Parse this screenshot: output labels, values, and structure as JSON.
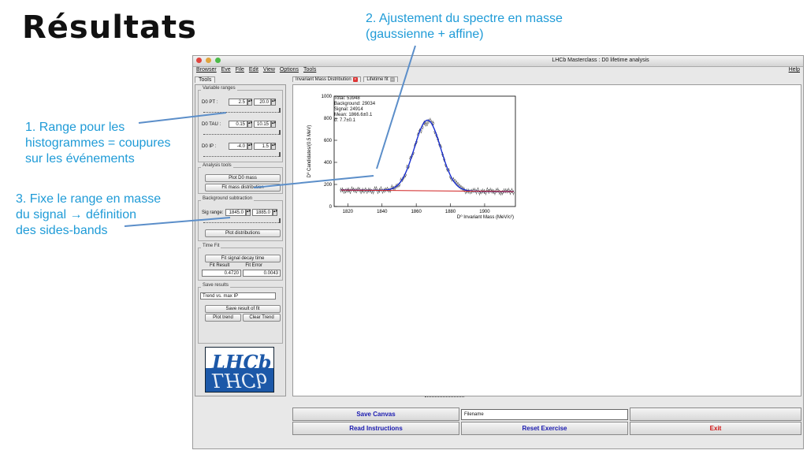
{
  "slide": {
    "title": "Résultats",
    "annotations": {
      "a1": [
        "1. Range pour les",
        "histogrammes = coupures",
        "sur les événements"
      ],
      "a2": [
        "2. Ajustement du spectre en masse",
        "(gaussienne + affine)"
      ],
      "a3": [
        "3. Fixe le range en masse",
        "du signal → définition",
        "des sides-bands"
      ]
    },
    "accent_color": "#1f9bd7"
  },
  "window": {
    "title": "LHCb Masterclass : D0 lifetime analysis",
    "menu": [
      "Browser",
      "Eve",
      "File",
      "Edit",
      "View",
      "Options",
      "Tools"
    ],
    "help": "Help"
  },
  "left": {
    "tab": "Tools",
    "variable_ranges": {
      "label": "Variable ranges",
      "pt_label": "D0 PT :",
      "pt_min": "2.5",
      "pt_max": "20.0",
      "tau_label": "D0 TAU :",
      "tau_min": "0.15",
      "tau_max": "10.15",
      "ip_label": "D0 IP :",
      "ip_min": "-4.0",
      "ip_max": "1.5"
    },
    "analysis": {
      "label": "Analysis tools",
      "plot": "Plot D0 mass",
      "fit": "Fit mass distribution"
    },
    "background": {
      "label": "Background subtraction",
      "sig_label": "Sig range:",
      "sig_min": "1845.0",
      "sig_max": "1885.0",
      "plot": "Plot distributions"
    },
    "timefit": {
      "label": "Time Fit",
      "fit": "Fit signal decay time",
      "result_label": "Fit Result",
      "error_label": "Fit Error",
      "result": "0.4720",
      "error": "0.0043"
    },
    "save": {
      "label": "Save results",
      "select": "Trend vs. max IP",
      "save_fit": "Save result of fit",
      "plot_trend": "Plot trend",
      "clear_trend": "Clear Trend"
    },
    "logo": "LHCb"
  },
  "main": {
    "tabs": [
      "Invariant Mass Distribution",
      "Lifetime fit"
    ]
  },
  "stats": [
    "Total: 53948",
    "Background: 29034",
    "Signal: 24914",
    "Mean: 1866.6±0.1",
    "σ: 7.7±0.1"
  ],
  "chart_data": {
    "type": "scatter",
    "xlabel": "D⁰ Invariant Mass (MeV/c²)",
    "ylabel": "D⁰ Candidates/(0.5 MeV)",
    "xlim": [
      1812,
      1918
    ],
    "ylim": [
      0,
      1000
    ],
    "xticks": [
      "1820",
      "1840",
      "1860",
      "1880",
      "1900"
    ],
    "yticks": [
      "0",
      "200",
      "400",
      "600",
      "800",
      "1000"
    ],
    "fit": {
      "mean": 1866.6,
      "sigma": 7.7,
      "bkg_left": 150,
      "bkg_right": 135,
      "amplitude": 640
    },
    "series": [
      {
        "values_description_only": false,
        "color": "#000000"
      }
    ],
    "fit_color": "#1a2fd0",
    "background_color": "#d02020"
  },
  "bottom": {
    "save_canvas": "Save Canvas",
    "filename": "Filename",
    "read_instructions": "Read Instructions",
    "reset_exercise": "Reset Exercise",
    "exit": "Exit",
    "button_text_color": "#1a1ab0",
    "exit_color": "#d01010"
  }
}
